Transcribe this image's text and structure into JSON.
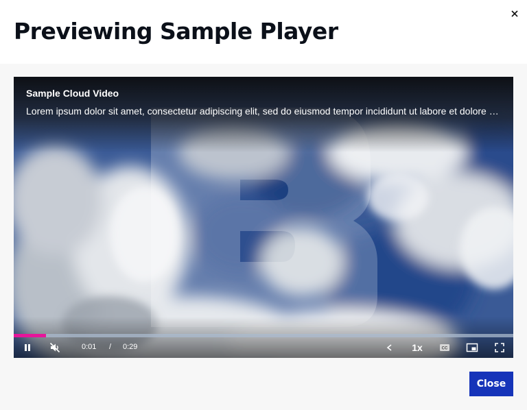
{
  "modal": {
    "title": "Previewing Sample Player",
    "close_icon": "close-icon",
    "close_button_label": "Close"
  },
  "video": {
    "title": "Sample Cloud Video",
    "description": "Lorem ipsum dolor sit amet, consectetur adipiscing elit, sed do eiusmod tempor incididunt ut labore et dolore magna aliqua.",
    "watermark_icon": "brand-logo-watermark"
  },
  "controls": {
    "current_time": "0:01",
    "time_separator": "/",
    "duration": "0:29",
    "playback_rate": "1x",
    "progress_fraction": 0.065,
    "icons": [
      "pause-icon",
      "muted-icon",
      "share-icon",
      "captions-icon",
      "picture-in-picture-icon",
      "fullscreen-icon"
    ]
  },
  "colors": {
    "progress": "#e6159a",
    "primary_button": "#1634b9",
    "title_text": "#0b1019"
  }
}
